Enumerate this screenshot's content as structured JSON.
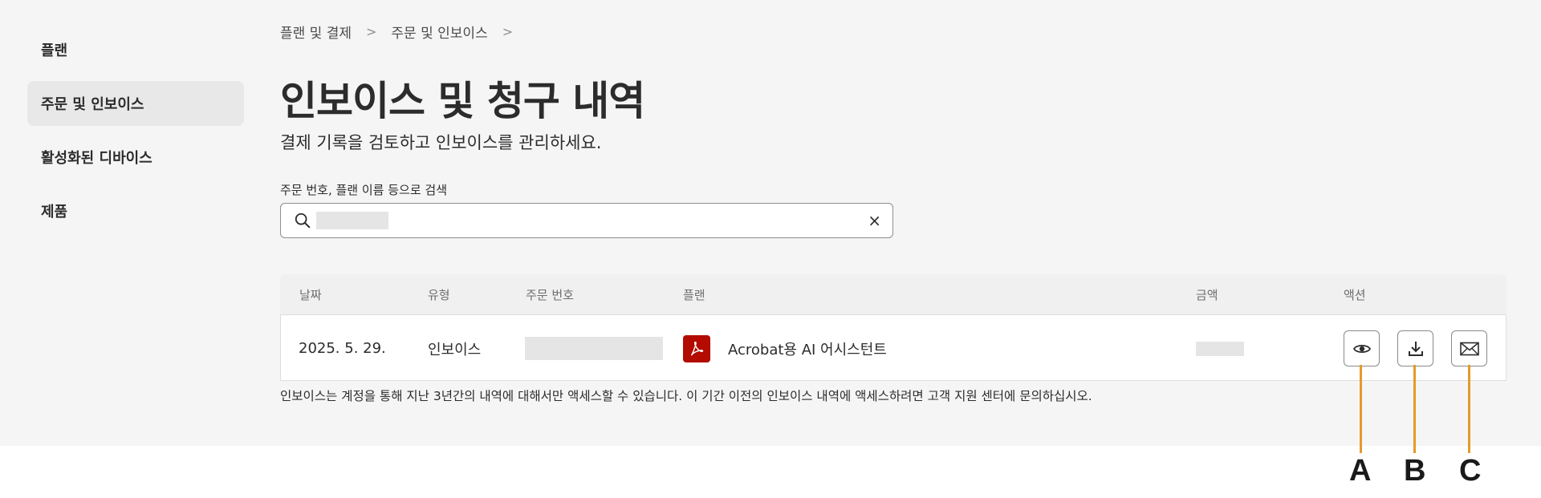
{
  "sidebar": {
    "items": [
      {
        "label": "플랜"
      },
      {
        "label": "주문 및 인보이스"
      },
      {
        "label": "활성화된 디바이스"
      },
      {
        "label": "제품"
      }
    ]
  },
  "breadcrumb": {
    "items": [
      {
        "label": "플랜 및 결제"
      },
      {
        "label": "주문 및 인보이스"
      }
    ],
    "separator": ">"
  },
  "page": {
    "title": "인보이스 및 청구 내역",
    "subtitle": "결제 기록을 검토하고 인보이스를 관리하세요."
  },
  "search": {
    "label": "주문 번호, 플랜 이름 등으로 검색",
    "value": "",
    "clear_glyph": "×",
    "icon": "search-icon"
  },
  "table": {
    "columns": [
      "날짜",
      "유형",
      "주문 번호",
      "플랜",
      "금액",
      "액션"
    ],
    "rows": [
      {
        "date": "2025. 5. 29.",
        "type": "인보이스",
        "order_number": "",
        "plan": "Acrobat용 AI 어시스턴트",
        "plan_icon": "acrobat-pdf-icon",
        "amount": "",
        "actions": [
          {
            "icon": "view-eye-icon"
          },
          {
            "icon": "download-icon"
          },
          {
            "icon": "email-envelope-icon"
          }
        ]
      }
    ]
  },
  "footnote": "인보이스는 계정을 통해 지난 3년간의 내역에 대해서만 액세스할 수 있습니다. 이 기간 이전의 인보이스 내역에 액세스하려면 고객 지원 센터에 문의하십시오.",
  "annotations": {
    "labels": [
      "A",
      "B",
      "C"
    ],
    "color": "#e59a2a"
  },
  "colors": {
    "background": "#f5f5f5",
    "sidebar_active": "#e8e8e8",
    "acrobat_red": "#b30b00"
  }
}
